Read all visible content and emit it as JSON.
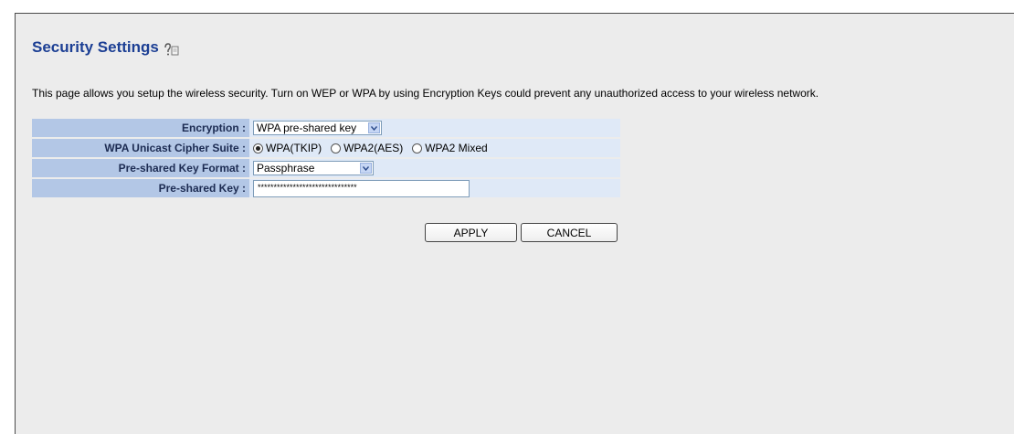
{
  "page": {
    "title": "Security Settings",
    "description": "This page allows you setup the wireless security. Turn on WEP or WPA by using Encryption Keys could prevent any unauthorized access to your wireless network."
  },
  "form": {
    "encryption": {
      "label": "Encryption :",
      "value": "WPA pre-shared key"
    },
    "cipher_suite": {
      "label": "WPA Unicast Cipher Suite :",
      "options": [
        "WPA(TKIP)",
        "WPA2(AES)",
        "WPA2 Mixed"
      ],
      "selected": "WPA(TKIP)"
    },
    "key_format": {
      "label": "Pre-shared Key Format :",
      "value": "Passphrase"
    },
    "psk": {
      "label": "Pre-shared Key :",
      "value": "*******************************"
    }
  },
  "buttons": {
    "apply": "APPLY",
    "cancel": "CANCEL"
  },
  "colors": {
    "title": "#1c3f94",
    "label_bg": "#b3c7e6",
    "value_bg": "#dfe9f7",
    "page_bg": "#ececec"
  },
  "icons": {
    "help": "help-icon",
    "dropdown": "chevron-down-icon"
  }
}
